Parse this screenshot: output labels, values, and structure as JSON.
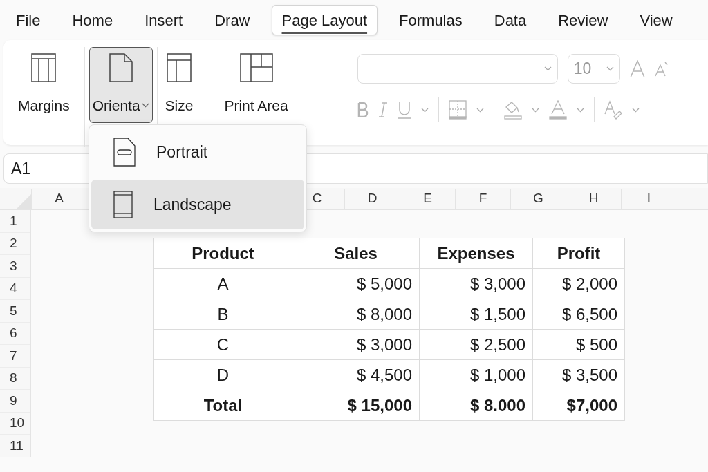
{
  "menu_tabs": [
    {
      "label": "File",
      "selected": false
    },
    {
      "label": "Home",
      "selected": false
    },
    {
      "label": "Insert",
      "selected": false
    },
    {
      "label": "Draw",
      "selected": false
    },
    {
      "label": "Page Layout",
      "selected": true
    },
    {
      "label": "Formulas",
      "selected": false
    },
    {
      "label": "Data",
      "selected": false
    },
    {
      "label": "Review",
      "selected": false
    },
    {
      "label": "View",
      "selected": false
    }
  ],
  "ribbon": {
    "buttons": [
      {
        "label": "Margins",
        "kind": "margins",
        "selected": false,
        "has_caret": false
      },
      {
        "label": "Orienta",
        "kind": "orientation",
        "selected": true,
        "has_caret": true
      },
      {
        "label": "Size",
        "kind": "size",
        "selected": false,
        "has_caret": false
      },
      {
        "label": "Print Area",
        "kind": "print_area",
        "selected": false,
        "has_caret": false
      }
    ],
    "font": {
      "size": "10",
      "disabled": true
    }
  },
  "orientation_menu": {
    "items": [
      {
        "label": "Portrait",
        "kind": "portrait",
        "selected": false
      },
      {
        "label": "Landscape",
        "kind": "landscape",
        "selected": true
      }
    ]
  },
  "name_box": "A1",
  "column_headers": [
    "A",
    "C",
    "D",
    "E",
    "F",
    "G",
    "H",
    "I"
  ],
  "row_headers": [
    "1",
    "2",
    "3",
    "4",
    "5",
    "6",
    "7",
    "8",
    "9",
    "10",
    "11"
  ],
  "table": {
    "columns": [
      "Product",
      "Sales",
      "Expenses",
      "Profit"
    ],
    "rows": [
      {
        "cells": [
          "A",
          "$ 5,000",
          "$ 3,000",
          "$ 2,000"
        ],
        "total": false
      },
      {
        "cells": [
          "B",
          "$ 8,000",
          "$ 1,500",
          "$ 6,500"
        ],
        "total": false
      },
      {
        "cells": [
          "C",
          "$ 3,000",
          "$ 2,500",
          "$ 500"
        ],
        "total": false
      },
      {
        "cells": [
          "D",
          "$ 4,500",
          "$ 1,000",
          "$ 3,500"
        ],
        "total": false
      },
      {
        "cells": [
          "Total",
          "$ 15,000",
          "$ 8.000",
          "$7,000"
        ],
        "total": true
      }
    ]
  }
}
